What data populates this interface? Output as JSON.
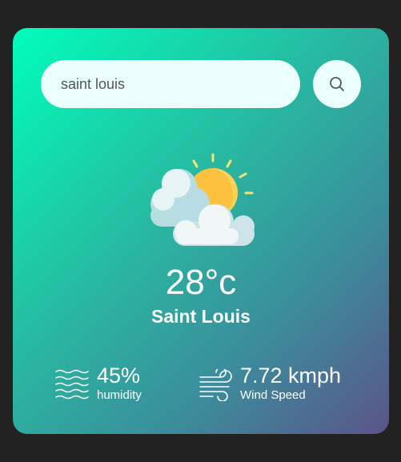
{
  "search": {
    "value": "saint louis",
    "button_icon": "search-icon"
  },
  "weather": {
    "icon": "partly-cloudy-icon",
    "temperature": "28°c",
    "city": "Saint Louis"
  },
  "details": {
    "humidity": {
      "icon": "humidity-waves-icon",
      "value": "45%",
      "label": "humidity"
    },
    "wind": {
      "icon": "wind-icon",
      "value": "7.72 kmph",
      "label": "Wind Speed"
    }
  },
  "colors": {
    "background": "#222222",
    "gradient_start": "#00feba",
    "gradient_end": "#5b548a",
    "input_bg": "#ebfffc",
    "text": "#ffffff"
  }
}
